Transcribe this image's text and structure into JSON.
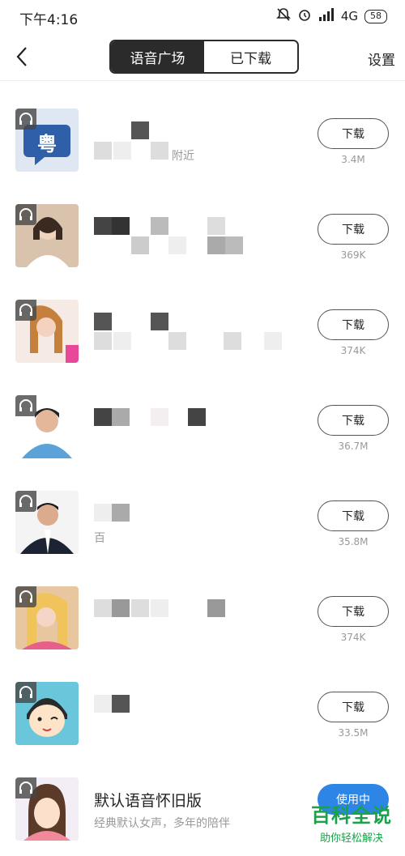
{
  "status": {
    "time": "下午4:16",
    "network": "4G",
    "battery": "58"
  },
  "nav": {
    "tab_active": "语音广场",
    "tab_inactive": "已下载",
    "settings": "设置"
  },
  "items": [
    {
      "title": "",
      "subtitle": "附近",
      "button": "下载",
      "size": "3.4M"
    },
    {
      "title": "",
      "subtitle": "",
      "button": "下载",
      "size": "369K"
    },
    {
      "title": "",
      "subtitle": "",
      "button": "下载",
      "size": "374K"
    },
    {
      "title": "",
      "subtitle": "",
      "button": "下载",
      "size": "36.7M"
    },
    {
      "title": "",
      "subtitle": "百",
      "button": "下载",
      "size": "35.8M"
    },
    {
      "title": "",
      "subtitle": "",
      "button": "下载",
      "size": "374K"
    },
    {
      "title": "",
      "subtitle": "",
      "button": "下载",
      "size": "33.5M"
    },
    {
      "title": "默认语音怀旧版",
      "subtitle": "经典默认女声，多年的陪伴",
      "button": "使用中",
      "size": ""
    }
  ],
  "avatar_glyph": "粤",
  "watermark": {
    "title": "百科全说",
    "subtitle": "助你轻松解决"
  }
}
